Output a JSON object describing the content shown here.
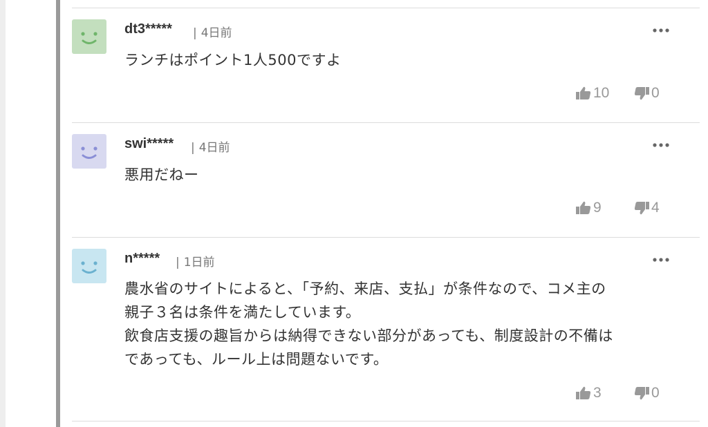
{
  "comments": [
    {
      "author": "dt3*****",
      "time": "4日前",
      "avatar_color": "#c3dfbe",
      "face_color": "#6fb56a",
      "body": "ランチはポイント1人500ですよ",
      "likes": "10",
      "dislikes": "0"
    },
    {
      "author": "swi*****",
      "time": "4日前",
      "avatar_color": "#d8d9f0",
      "face_color": "#8a8fd6",
      "body": "悪用だねー",
      "likes": "9",
      "dislikes": "4"
    },
    {
      "author": "n*****",
      "time": "1日前",
      "avatar_color": "#c8e6f1",
      "face_color": "#6bb1cf",
      "body": "農水省のサイトによると、「予約、来店、支払」が条件なので、コメ主の\n親子３名は条件を満たしています。\n飲食店支援の趣旨からは納得できない部分があっても、制度設計の不備は\nであっても、ルール上は問題ないです。",
      "likes": "3",
      "dislikes": "0"
    }
  ],
  "separator": "|",
  "icons": {
    "more": "more-dots-icon",
    "like": "thumbs-up-icon",
    "dislike": "thumbs-down-icon"
  }
}
